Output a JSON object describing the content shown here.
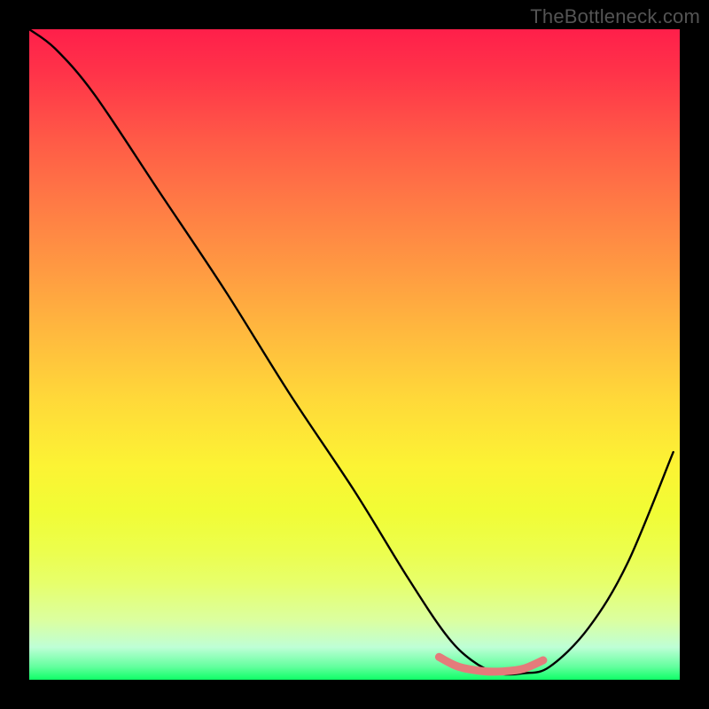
{
  "watermark": "TheBottleneck.com",
  "chart_data": {
    "type": "line",
    "title": "",
    "xlabel": "",
    "ylabel": "",
    "xlim": [
      0,
      100
    ],
    "ylim": [
      0,
      100
    ],
    "series": [
      {
        "name": "main-curve",
        "color": "#000000",
        "x": [
          0,
          4,
          10,
          20,
          30,
          40,
          50,
          58,
          64,
          68,
          72,
          76,
          80,
          86,
          92,
          99
        ],
        "values": [
          100,
          97,
          90,
          75,
          60,
          44,
          29,
          16,
          7,
          3,
          1,
          1,
          2,
          8,
          18,
          35
        ]
      },
      {
        "name": "highlight-segment",
        "color": "#e47b7b",
        "x": [
          63,
          66,
          70,
          73,
          76,
          79
        ],
        "values": [
          3.5,
          2.0,
          1.3,
          1.3,
          1.7,
          3.0
        ]
      }
    ],
    "note": "Values are read from the plot in percent of each axis; not labeled in source image."
  }
}
